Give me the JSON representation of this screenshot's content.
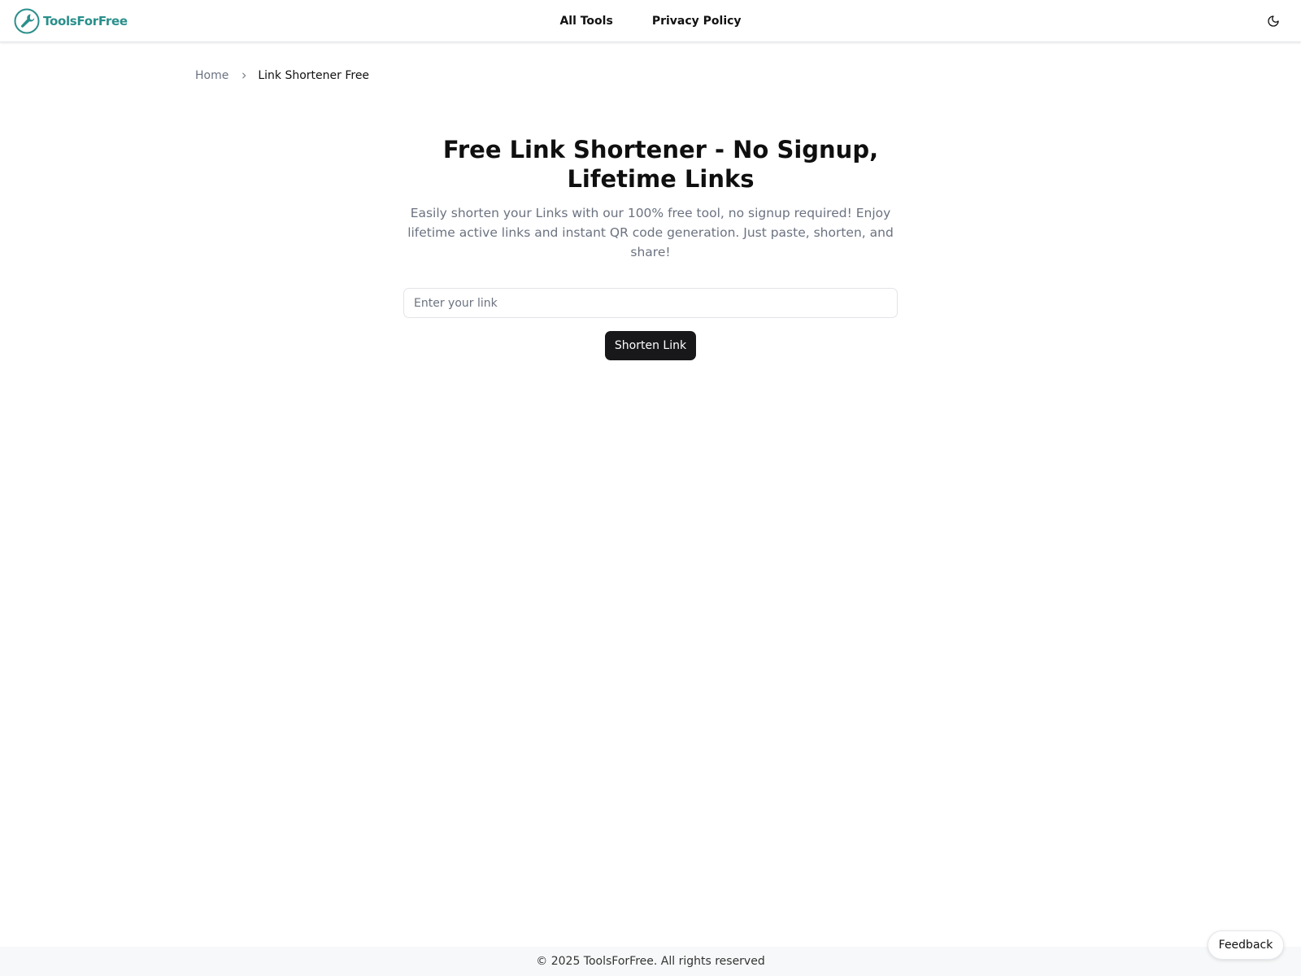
{
  "header": {
    "brand": {
      "name": "ToolsForFree",
      "icon": "wrench-icon",
      "color": "#2a8f8b"
    },
    "nav": [
      {
        "label": "All Tools"
      },
      {
        "label": "Privacy Policy"
      }
    ],
    "theme_toggle": {
      "icon": "moon-icon"
    }
  },
  "breadcrumb": {
    "home": "Home",
    "separator_icon": "chevron-right-icon",
    "current": "Link Shortener Free"
  },
  "main": {
    "title": "Free Link Shortener - No Signup, Lifetime Links",
    "description": "Easily shorten your Links with our 100% free tool, no signup required! Enjoy lifetime active links and instant QR code generation. Just paste, shorten, and share!",
    "input": {
      "value": "",
      "placeholder": "Enter your link"
    },
    "submit_label": "Shorten Link",
    "button_color": "#18181b"
  },
  "footer": {
    "copyright": "© 2025 ToolsForFree. All rights reserved"
  },
  "feedback": {
    "label": "Feedback"
  }
}
